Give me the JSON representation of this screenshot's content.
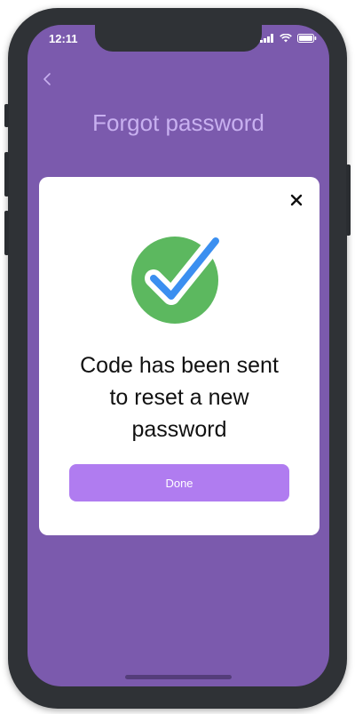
{
  "status_bar": {
    "time": "12:11"
  },
  "header": {
    "back_icon": "chevron-left-icon",
    "title": "Forgot password"
  },
  "modal": {
    "close_icon": "close-icon",
    "success_icon": "check-circle-icon",
    "message": "Code has been sent to reset a new password",
    "done_label": "Done"
  },
  "colors": {
    "background": "#7b5aad",
    "title": "#c8b0f0",
    "button": "#b07cf0",
    "check_circle": "#5cb85f",
    "check_mark": "#3b8ff0"
  }
}
